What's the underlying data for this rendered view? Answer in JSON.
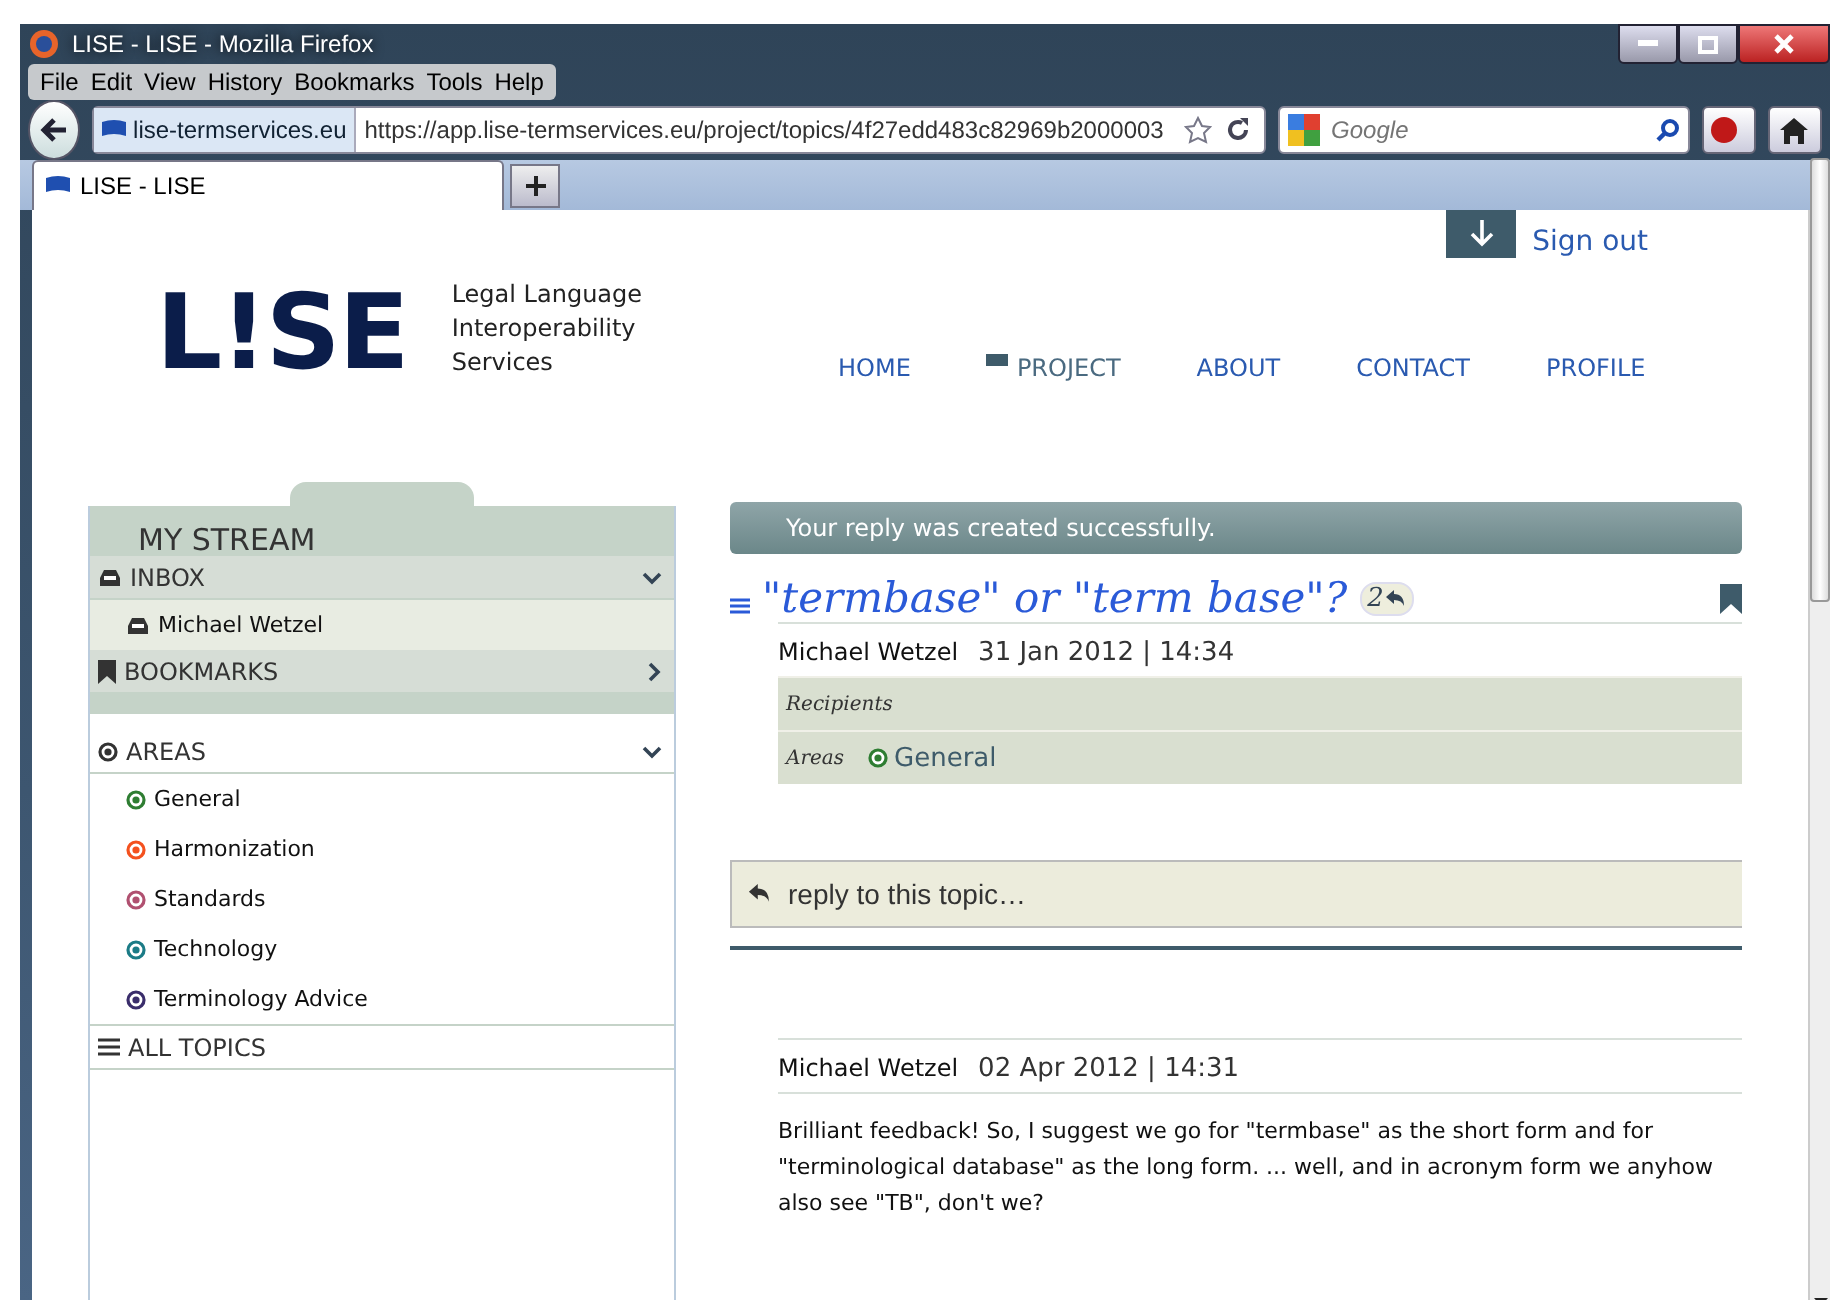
{
  "browser": {
    "title": "LISE - LISE - Mozilla Firefox",
    "menu": [
      "File",
      "Edit",
      "View",
      "History",
      "Bookmarks",
      "Tools",
      "Help"
    ],
    "site_identity": "lise-termservices.eu",
    "url": "https://app.lise-termservices.eu/project/topics/4f27edd483c82969b2000003",
    "search_placeholder": "Google",
    "tabs": [
      {
        "label": "LISE - LISE",
        "selected": true
      }
    ]
  },
  "header": {
    "sign_out": "Sign out",
    "logo": "L!SE",
    "tagline": [
      "Legal Language",
      "Interoperability",
      "Services"
    ],
    "nav": [
      {
        "label": "HOME",
        "kind": "link"
      },
      {
        "label": "PROJECT",
        "kind": "flag"
      },
      {
        "label": "ABOUT",
        "kind": "link"
      },
      {
        "label": "CONTACT",
        "kind": "link"
      },
      {
        "label": "PROFILE",
        "kind": "link"
      }
    ]
  },
  "sidebar": {
    "title": "MY STREAM",
    "inbox": {
      "label": "INBOX",
      "expanded": true,
      "items": [
        "Michael Wetzel"
      ]
    },
    "bookmarks": {
      "label": "BOOKMARKS",
      "expanded": false
    },
    "areas": {
      "label": "AREAS",
      "expanded": true,
      "items": [
        {
          "label": "General",
          "color": "#2e7d32"
        },
        {
          "label": "Harmonization",
          "color": "#f4511e"
        },
        {
          "label": "Standards",
          "color": "#b05070"
        },
        {
          "label": "Technology",
          "color": "#1b7b86"
        },
        {
          "label": "Terminology Advice",
          "color": "#3a2d6b"
        }
      ]
    },
    "all_topics": "ALL TOPICS"
  },
  "main": {
    "notice": "Your reply was created successfully.",
    "topic": {
      "title": "\"termbase\" or \"term base\"?",
      "reply_count": "2",
      "bookmarked": true,
      "author": "Michael Wetzel",
      "date": "31 Jan 2012 | 14:34",
      "recipients_label": "Recipients",
      "areas_label": "Areas",
      "areas": [
        {
          "label": "General",
          "color": "#2e7d32"
        }
      ]
    },
    "reply_placeholder": "reply to this topic…",
    "replies": [
      {
        "author": "Michael Wetzel",
        "date": "02 Apr 2012 | 14:31",
        "body": "Brilliant feedback! So, I suggest we go for \"termbase\" as the short form and for \"terminological database\" as the long form. ... well, and in acronym form we anyhow also see \"TB\", don't we?"
      }
    ]
  }
}
